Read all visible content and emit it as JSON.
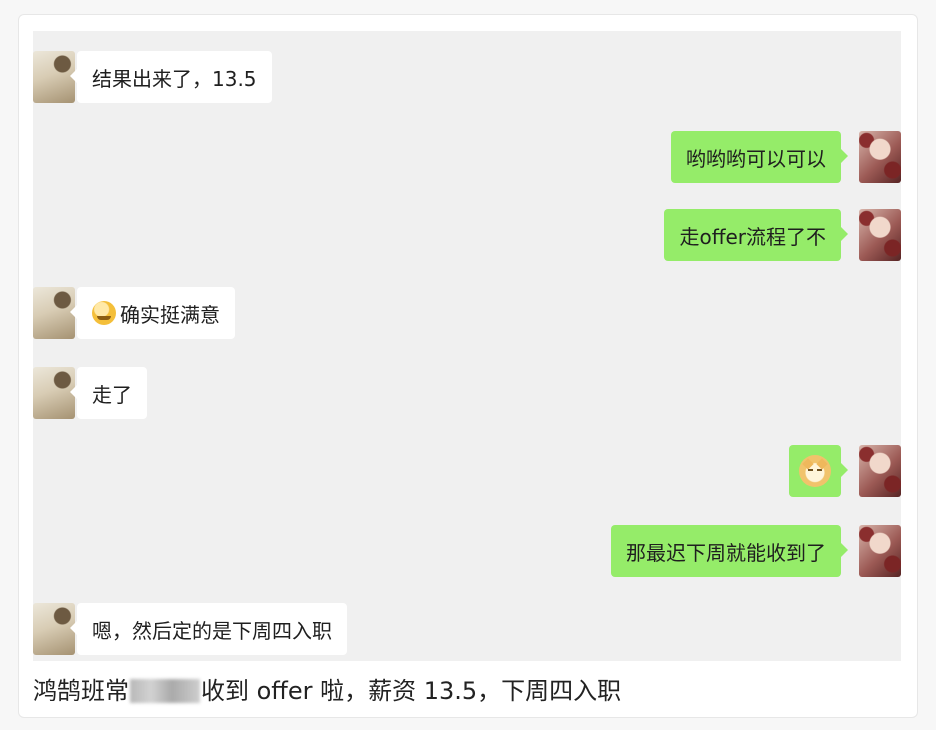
{
  "messages": {
    "m1": "结果出来了，13.5",
    "m2": "哟哟哟可以可以",
    "m3": "走offer流程了不",
    "m4": "确实挺满意",
    "m5": "走了",
    "m7": "那最迟下周就能收到了",
    "m8": "嗯，然后定的是下周四入职"
  },
  "emojis": {
    "m4_icon": "smiling-face-emoji",
    "m6_icon": "doge-sticker"
  },
  "caption": {
    "before_blur": "鸿鹄班常",
    "after_blur": "收到 offer 啦，薪资 13.5，下周四入职"
  },
  "colors": {
    "incoming_bubble": "#ffffff",
    "outgoing_bubble": "#95ec69",
    "chat_background": "#f0f0f0"
  }
}
